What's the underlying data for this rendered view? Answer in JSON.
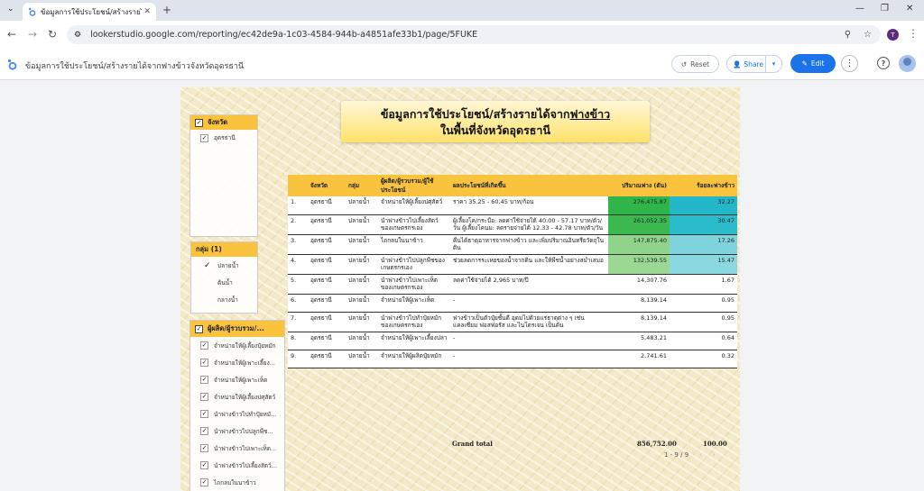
{
  "browser": {
    "tab_title": "ข้อมูลการใช้ประโยชน์/สร้างรายได้จาก",
    "url": "lookerstudio.google.com/reporting/ec42de9a-1c03-4584-944b-a4851afe33b1/page/5FUKE",
    "profile_initial": "T"
  },
  "app": {
    "report_title": "ข้อมูลการใช้ประโยชน์/สร้างรายได้จากฟางข้าวจังหวัดอุดรธานี",
    "reset_label": "Reset",
    "share_label": "Share",
    "edit_label": "Edit"
  },
  "report": {
    "title_line1_a": "ข้อมูลการใช้ประโยชน์/สร้างรายได้จาก",
    "title_line1_b": "ฟางข้าว",
    "title_line2": "ในพื้นที่จังหวัดอุดรธานี"
  },
  "filters": {
    "province": {
      "header": "จังหวัด",
      "items": [
        "อุดรธานี"
      ]
    },
    "group": {
      "header": "กลุ่ม (1)",
      "items": [
        "ปลายน้ำ",
        "ต้นน้ำ",
        "กลางน้ำ"
      ]
    },
    "producer": {
      "header": "ผู้ผลิต/ผู้รวบรวม/...",
      "items": [
        "จำหน่ายให้ผู้เลี้ยงปุ๋ยหมัก",
        "จำหน่ายให้ผู้เพาะเลี้ยง...",
        "จำหน่ายให้ผู้เพาะเห็ด",
        "จำหน่ายให้ผู้เลี้ยงปศุสัตว์",
        "นำฟางข้าวไปทำปุ๋ยหมั...",
        "นำฟางข้าวไปปลูกพืช...",
        "นำฟางข้าวไปเพาะเห็ด...",
        "นำฟางข้าวไปเลี้ยงสัตว์...",
        "ไถกลบในนาข้าว"
      ]
    }
  },
  "table": {
    "headers": [
      "",
      "จังหวัด",
      "กลุ่ม",
      "ผู้ผลิต/ผู้รวบรวม/ผู้ใช้ประโยชน์",
      "ผลประโยชน์ที่เกิดขึ้น",
      "ปริมาณฟาง (ตัน)",
      "ร้อยละฟางข้าว"
    ],
    "rows": [
      {
        "no": "1.",
        "prov": "อุดรธานี",
        "grp": "ปลายน้ำ",
        "who": "จำหน่ายให้ผู้เลี้ยงปศุสัตว์",
        "benefit": "ราคา 35.25 - 60.45 บาท/ก้อน",
        "qty": "276,475.87",
        "pct": "32.27",
        "qc": "#2fb54a",
        "pc": "#22b8c9"
      },
      {
        "no": "2.",
        "prov": "อุดรธานี",
        "grp": "ปลายน้ำ",
        "who": "นำฟางข้าวไปเลี้ยงสัตว์ของเกษตรกรเอง",
        "benefit": "ผู้เลี้ยงโค/กระบือ: ลดค่าใช้จ่ายได้ 40.00 - 57.17 บาท/ตัว/วัน ผู้เลี้ยงโคนม: ลดรายจ่ายได้ 12.33 - 42.78 บาท/ตัว/วัน",
        "qty": "261,052.35",
        "pct": "30.47",
        "qc": "#3cb94e",
        "pc": "#2bbccc"
      },
      {
        "no": "3.",
        "prov": "อุดรธานี",
        "grp": "ปลายน้ำ",
        "who": "ไถกลบในนาข้าว",
        "benefit": "คืนได้ธาตุอาหารจากฟางข้าว และเพิ่มปริมาณอินทรียวัตถุในดิน",
        "qty": "147,875.40",
        "pct": "17.26",
        "qc": "#8fd48a",
        "pc": "#7fd3dc"
      },
      {
        "no": "4.",
        "prov": "อุดรธานี",
        "grp": "ปลายน้ำ",
        "who": "นำฟางข้าวไปปลูกพืชของเกษตรกรเอง",
        "benefit": "ช่วยลดการระเหยของน้ำจากดิน และให้พืชน้ำอย่างสม่ำเสมอ",
        "qty": "132,539.55",
        "pct": "15.47",
        "qc": "#9ad893",
        "pc": "#8ad8e0"
      },
      {
        "no": "5.",
        "prov": "อุดรธานี",
        "grp": "ปลายน้ำ",
        "who": "นำฟางข้าวไปเพาะเห็ดของเกษตรกรเอง",
        "benefit": "ลดค่าใช้จ่ายได้ 2,965 บาท/ปี",
        "qty": "14,307.76",
        "pct": "1.67",
        "qc": "",
        "pc": ""
      },
      {
        "no": "6.",
        "prov": "อุดรธานี",
        "grp": "ปลายน้ำ",
        "who": "จำหน่ายให้ผู้เพาะเห็ด",
        "benefit": "-",
        "qty": "8,139.14",
        "pct": "0.95",
        "qc": "",
        "pc": ""
      },
      {
        "no": "7.",
        "prov": "อุดรธานี",
        "grp": "ปลายน้ำ",
        "who": "นำฟางข้าวไปทำปุ๋ยหมักของเกษตรกรเอง",
        "benefit": "ฟางข้าวเป็นตัวปุ๋ยชั้นดี อุดมไปด้วยแร่ธาตุต่าง ๆ เช่น แคลเซียม ฟอสฟอรัส และไนโตรเจน เป็นต้น",
        "qty": "8,139.14",
        "pct": "0.95",
        "qc": "",
        "pc": ""
      },
      {
        "no": "8.",
        "prov": "อุดรธานี",
        "grp": "ปลายน้ำ",
        "who": "จำหน่ายให้ผู้เพาะเลี้ยงปลา",
        "benefit": "-",
        "qty": "5,483.21",
        "pct": "0.64",
        "qc": "",
        "pc": ""
      },
      {
        "no": "9.",
        "prov": "อุดรธานี",
        "grp": "ปลายน้ำ",
        "who": "จำหน่ายให้ผู้ผลิตปุ๋ยหมัก",
        "benefit": "-",
        "qty": "2,741.61",
        "pct": "0.32",
        "qc": "",
        "pc": ""
      }
    ],
    "grand_total_label": "Grand total",
    "grand_total_qty": "856,752.00",
    "grand_total_pct": "100.00",
    "pager": "1 - 9 / 9"
  }
}
